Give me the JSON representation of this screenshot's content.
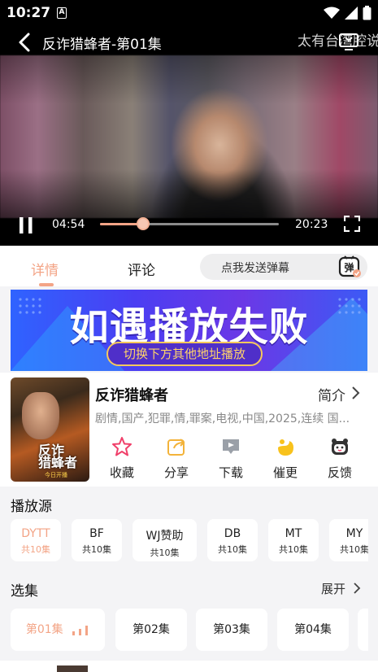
{
  "status_bar": {
    "time": "10:27",
    "a_icon": "A"
  },
  "player": {
    "title": "反诈猎蜂者-第01集",
    "marquee": "太有台湾腔说",
    "current_time": "04:54",
    "total_time": "20:23",
    "progress": 0.24
  },
  "tabs": {
    "details": "详情",
    "comments": "评论",
    "danmu_placeholder": "点我发送弹幕",
    "danmu_icon_label": "弹"
  },
  "banner": {
    "title": "如遇播放失败",
    "subtitle": "切换下方其他地址播放"
  },
  "info": {
    "poster_title": "反诈\n猎蜂者",
    "poster_sub": "今日开播",
    "title": "反诈猎蜂者",
    "intro_label": "简介",
    "genres": "剧情,国产,犯罪,情,罪案,电视,中国,2025,连续 国...",
    "actions": [
      {
        "label": "收藏",
        "icon": "star-icon"
      },
      {
        "label": "分享",
        "icon": "share-icon"
      },
      {
        "label": "下载",
        "icon": "download-icon"
      },
      {
        "label": "催更",
        "icon": "urge-icon"
      },
      {
        "label": "反馈",
        "icon": "feedback-icon"
      }
    ]
  },
  "sources": {
    "title": "播放源",
    "items": [
      {
        "name": "DYTT",
        "count": "共10集"
      },
      {
        "name": "BF",
        "count": "共10集"
      },
      {
        "name": "WJ赞助",
        "count": "共10集"
      },
      {
        "name": "DB",
        "count": "共10集"
      },
      {
        "name": "MT",
        "count": "共10集"
      },
      {
        "name": "MY",
        "count": "共10集"
      }
    ]
  },
  "episodes": {
    "title": "选集",
    "expand_label": "展开",
    "items": [
      "第01集",
      "第02集",
      "第03集",
      "第04集"
    ]
  },
  "colors": {
    "accent": "#f3a486",
    "banner_blue": "#3c4ef2",
    "pill_gold": "#ffd36a"
  }
}
